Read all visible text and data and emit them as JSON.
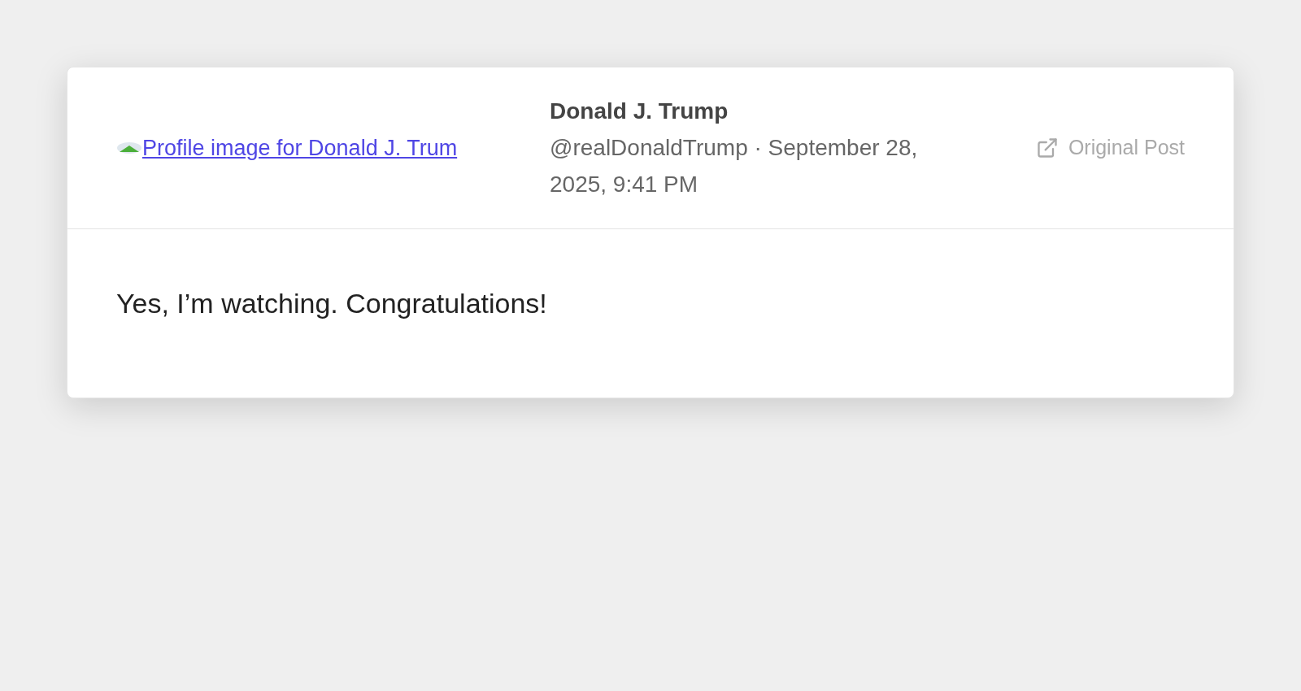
{
  "post": {
    "avatar_alt": "Profile image for Donald J. Trum",
    "author": "Donald J. Trump",
    "meta": "@realDonaldTrump · September 28, 2025, 9:41 PM",
    "link": "Original Post",
    "body": "Yes, I’m watching. Congratulations!"
  }
}
